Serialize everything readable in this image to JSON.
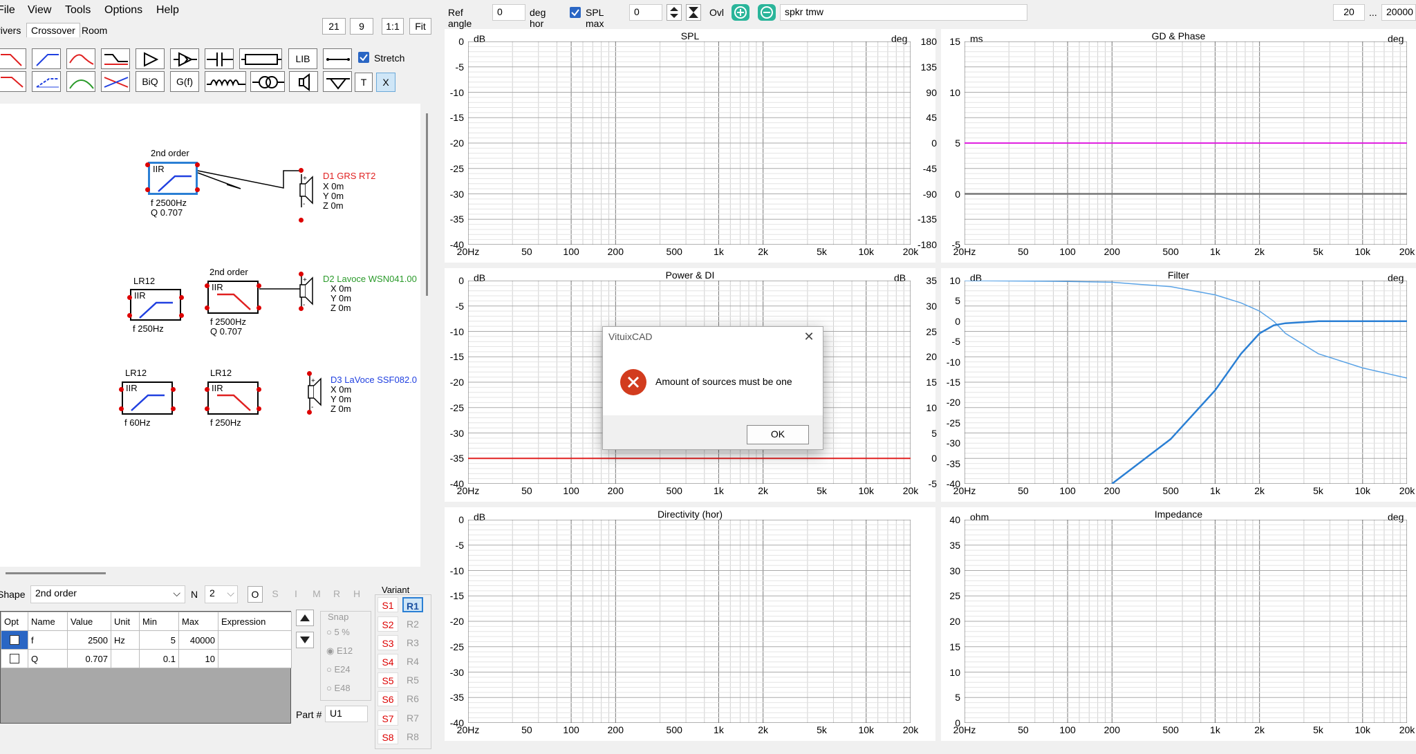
{
  "menu": [
    "File",
    "View",
    "Tools",
    "Options",
    "Help"
  ],
  "tabs": [
    "Drivers",
    "Crossover",
    "Room"
  ],
  "toolbar": {
    "lib": "LIB",
    "biq": "BiQ",
    "gf": "G(f)",
    "t": "T",
    "x": "X",
    "stretch": "Stretch"
  },
  "zoom": {
    "a": "21",
    "b": "9",
    "ratio": "1:1",
    "fit": "Fit"
  },
  "schematic": {
    "block1_title": "2nd order",
    "block1_iir": "IIR",
    "block1_f": "f  2500Hz",
    "block1_q": "Q 0.707",
    "d1_name": "D1 GRS RT2",
    "d1_x": "X 0m",
    "d1_y": "Y 0m",
    "d1_z": "Z 0m",
    "block2_title": "LR12",
    "block2_iir": "IIR",
    "block2_f": "f  250Hz",
    "block3_title": "2nd order",
    "block3_iir": "IIR",
    "block3_f": "f  2500Hz",
    "block3_q": "Q 0.707",
    "d2_name": "D2 Lavoce WSN041.00",
    "d2_x": "X 0m",
    "d2_y": "Y 0m",
    "d2_z": "Z 0m",
    "block4_title": "LR12",
    "block4_iir": "IIR",
    "block4_f": "f  60Hz",
    "block5_title": "LR12",
    "block5_iir": "IIR",
    "block5_f": "f  250Hz",
    "d3_name": "D3 LaVoce SSF082.0",
    "d3_x": "X 0m",
    "d3_y": "Y 0m",
    "d3_z": "Z 0m",
    "colors": {
      "d1": "#e02020",
      "d2": "#2a9a2a",
      "d3": "#2040e0"
    }
  },
  "shape": {
    "label": "Shape",
    "value": "2nd order",
    "n_label": "N",
    "n_value": "2",
    "flags": [
      "O",
      "S",
      "I",
      "M",
      "R",
      "H"
    ]
  },
  "params": {
    "headers": [
      "Opt",
      "Name",
      "Value",
      "Unit",
      "Min",
      "Max",
      "Expression"
    ],
    "rows": [
      {
        "name": "f",
        "value": "2500",
        "unit": "Hz",
        "min": "5",
        "max": "40000",
        "expr": ""
      },
      {
        "name": "Q",
        "value": "0.707",
        "unit": "",
        "min": "0.1",
        "max": "10",
        "expr": ""
      }
    ]
  },
  "snap": {
    "label": "Snap",
    "options": [
      "5 %",
      "E12",
      "E24",
      "E48"
    ]
  },
  "variant": {
    "label": "Variant",
    "s": [
      "S1",
      "S2",
      "S3",
      "S4",
      "S5",
      "S6",
      "S7",
      "S8"
    ],
    "r": [
      "R1",
      "R2",
      "R3",
      "R4",
      "R5",
      "R6",
      "R7",
      "R8"
    ]
  },
  "part": {
    "label": "Part #",
    "value": "U1"
  },
  "topbar": {
    "ref_angle_label": "Ref angle",
    "ref_angle": "0",
    "deg_hor": "deg hor",
    "spl_max_label": "SPL max",
    "spl_max": "0",
    "ovl": "Ovl",
    "filename": "spkr tmw",
    "fmin": "20",
    "dots": "...",
    "fmax": "20000"
  },
  "x_ticks": [
    "20Hz",
    "50",
    "100",
    "200",
    "500",
    "1k",
    "2k",
    "5k",
    "10k",
    "20k"
  ],
  "charts": {
    "spl": {
      "title": "SPL",
      "left_unit": "dB",
      "right_unit": "deg",
      "left": [
        "0",
        "-5",
        "-10",
        "-15",
        "-20",
        "-25",
        "-30",
        "-35",
        "-40"
      ],
      "right": [
        "180",
        "135",
        "90",
        "45",
        "0",
        "-45",
        "-90",
        "-135",
        "-180"
      ]
    },
    "gd": {
      "title": "GD & Phase",
      "left_unit": "ms",
      "right_unit": "deg",
      "left": [
        "15",
        "10",
        "5",
        "0",
        "-5"
      ],
      "series_color": "#e020e0"
    },
    "power": {
      "title": "Power & DI",
      "left_unit": "dB",
      "right_unit": "dB",
      "left": [
        "0",
        "-5",
        "-10",
        "-15",
        "-20",
        "-25",
        "-30",
        "-35",
        "-40"
      ],
      "right": [
        "35",
        "30",
        "25",
        "20",
        "15",
        "10",
        "5",
        "0",
        "-5"
      ],
      "series_color": "#e02020"
    },
    "filter": {
      "title": "Filter",
      "left_unit": "dB",
      "right_unit": "deg",
      "left": [
        "10",
        "5",
        "0",
        "-5",
        "-10",
        "-15",
        "-20",
        "-25",
        "-30",
        "-35",
        "-40"
      ],
      "series_color": "#2a7fd4"
    },
    "directivity": {
      "title": "Directivity (hor)",
      "left_unit": "dB",
      "left": [
        "0",
        "-5",
        "-10",
        "-15",
        "-20",
        "-25",
        "-30",
        "-35",
        "-40"
      ]
    },
    "impedance": {
      "title": "Impedance",
      "left_unit": "ohm",
      "right_unit": "deg",
      "left": [
        "40",
        "35",
        "30",
        "25",
        "20",
        "15",
        "10",
        "5",
        "0"
      ]
    }
  },
  "chart_data": [
    {
      "type": "line",
      "title": "GD & Phase",
      "ylabel": "ms",
      "ylim": [
        -5,
        15
      ],
      "x": [
        20,
        20000
      ],
      "series": [
        {
          "values": [
            5,
            5
          ]
        },
        {
          "values": [
            0,
            0
          ]
        }
      ]
    },
    {
      "type": "line",
      "title": "Power & DI",
      "ylabel": "dB",
      "ylim": [
        -40,
        0
      ],
      "x": [
        20,
        20000
      ],
      "series": [
        {
          "values": [
            -35,
            -35
          ]
        }
      ]
    },
    {
      "type": "line",
      "title": "Filter",
      "ylabel": "dB",
      "ylim": [
        -40,
        10
      ],
      "x": [
        20,
        100,
        200,
        500,
        1000,
        1500,
        2000,
        2500,
        3000,
        5000,
        10000,
        20000
      ],
      "series": [
        {
          "values": [
            10,
            9.8,
            9.6,
            8.5,
            6.5,
            4.5,
            2.5,
            0,
            -3,
            -8,
            -11.5,
            -14
          ]
        },
        {
          "values": [
            -99,
            -99,
            -40,
            -29,
            -17,
            -8,
            -3,
            -1,
            -0.5,
            0,
            0,
            0
          ]
        }
      ]
    }
  ],
  "dialog": {
    "title": "VituixCAD",
    "message": "Amount of sources must be one",
    "ok": "OK"
  }
}
